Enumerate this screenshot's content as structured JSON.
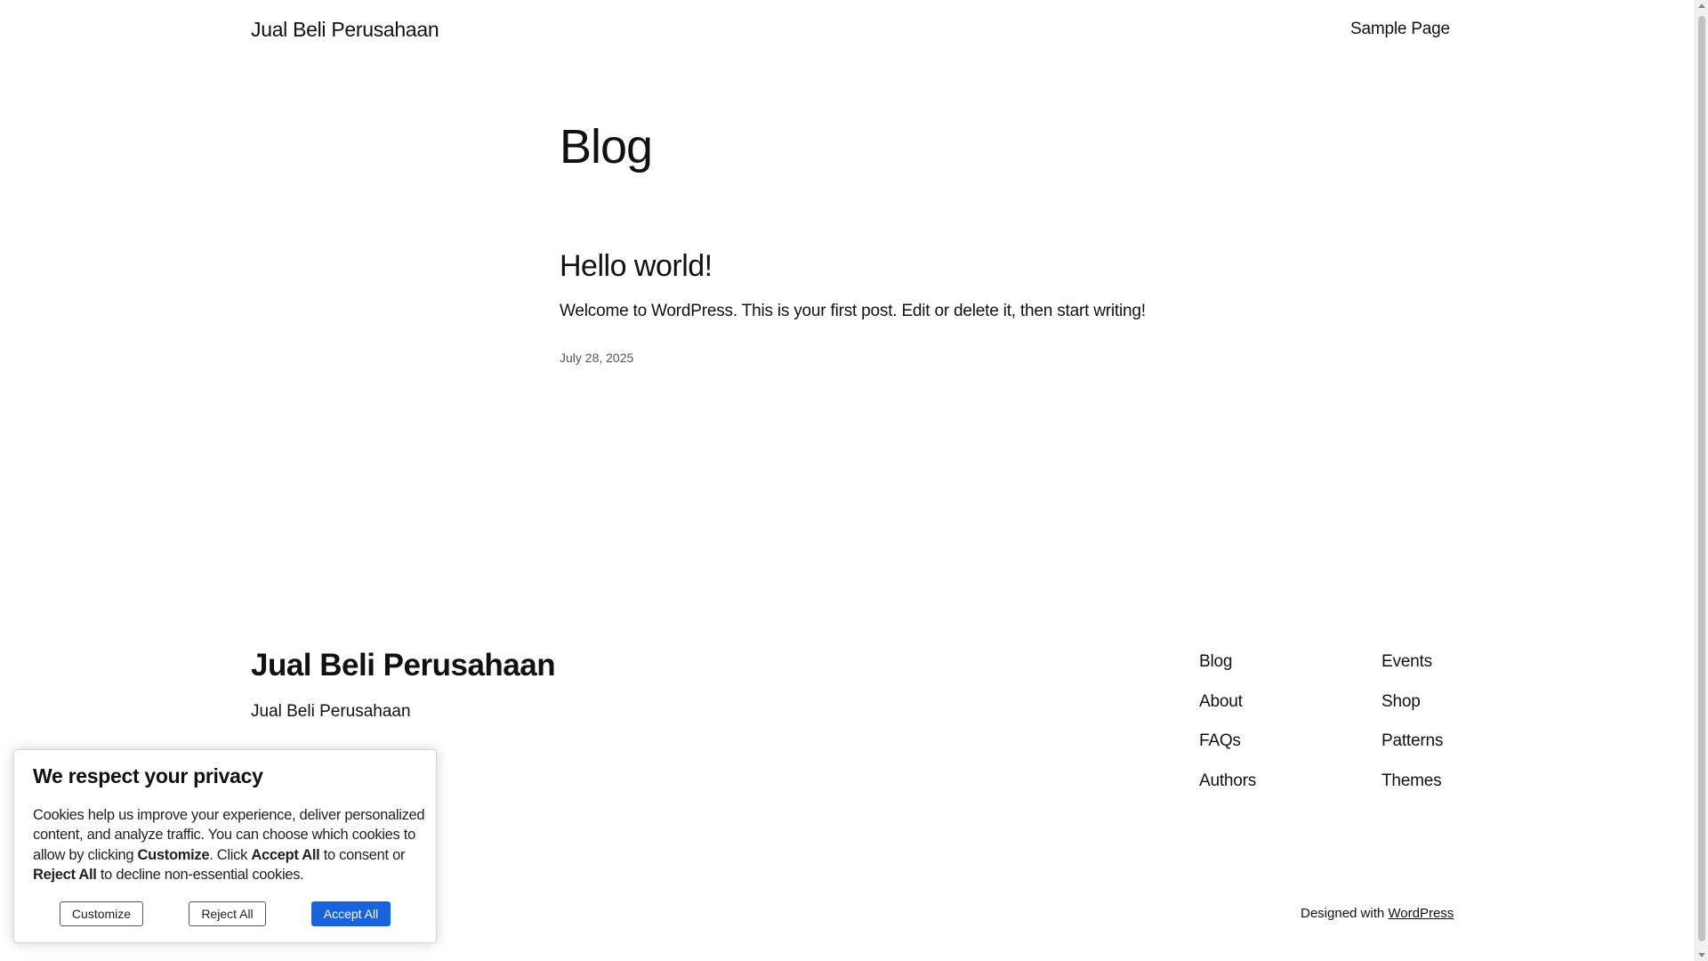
{
  "header": {
    "site_title": "Jual Beli Perusahaan",
    "nav": [
      "Sample Page"
    ]
  },
  "main": {
    "page_title": "Blog",
    "post": {
      "title": "Hello world!",
      "excerpt": "Welcome to WordPress. This is your first post. Edit or delete it, then start writing!",
      "date": "July 28, 2025"
    }
  },
  "footer": {
    "title": "Jual Beli Perusahaan",
    "tagline": "Jual Beli Perusahaan",
    "col1": [
      "Blog",
      "About",
      "FAQs",
      "Authors"
    ],
    "col2": [
      "Events",
      "Shop",
      "Patterns",
      "Themes"
    ],
    "credit_prefix": "Designed with ",
    "credit_link": "WordPress"
  },
  "cookie_banner": {
    "title": "We respect your privacy",
    "text_part1": "Cookies help us improve your experience, deliver personalized content, and analyze traffic. You can choose which cookies to allow by clicking ",
    "text_bold1": "Customize",
    "text_part2": ". Click ",
    "text_bold2": "Accept All",
    "text_part3": " to consent or ",
    "text_bold3": "Reject All",
    "text_part4": " to decline non-essential cookies.",
    "customize_label": "Customize",
    "reject_label": "Reject All",
    "accept_label": "Accept All",
    "accept_color": "#1863dc"
  }
}
